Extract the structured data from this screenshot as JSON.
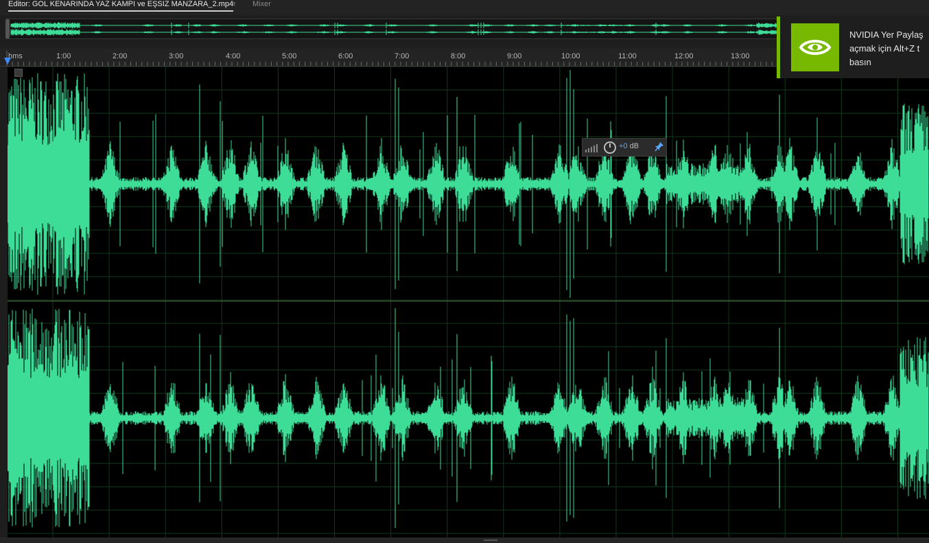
{
  "tabs": {
    "editor_label": "Editor: GOL KENARINDA YAZ KAMPI ve EŞSIZ MANZARA_2.mp4",
    "menu_glyph": "≡",
    "mixer_label": "Mixer"
  },
  "ruler": {
    "unit_label": "hms",
    "ticks": [
      "1:00",
      "2:00",
      "3:00",
      "4:00",
      "5:00",
      "6:00",
      "7:00",
      "8:00",
      "9:00",
      "10:00",
      "11:00",
      "12:00",
      "13:00"
    ]
  },
  "hud": {
    "value": "+0",
    "unit": "dB",
    "knob_icon": "volume-knob-icon",
    "pin_icon": "pin-icon"
  },
  "notification": {
    "line1": "NVIDIA Yer Paylaş",
    "line2": "açmak için Alt+Z t",
    "line3": "basın",
    "logo_icon": "nvidia-eye-icon"
  },
  "colors": {
    "waveform": "#3ddc97",
    "background": "#000000",
    "grid": "#0f3a1a",
    "accent": "#3d8bff",
    "nvidia_green": "#76b900"
  }
}
